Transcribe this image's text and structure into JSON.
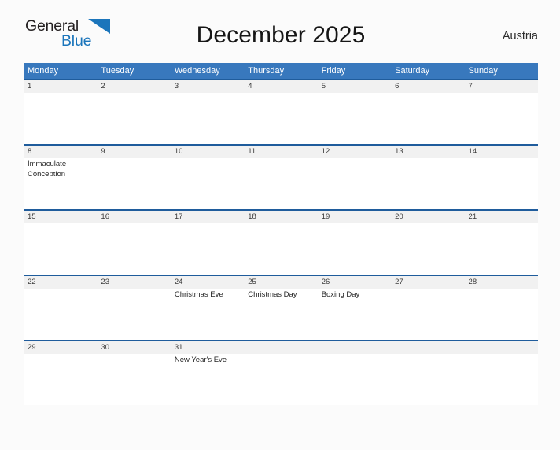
{
  "brand": {
    "name_part1": "General",
    "name_part2": "Blue",
    "flag_icon": "triangle-flag-icon",
    "accent_color": "#1b75bb"
  },
  "header": {
    "title": "December 2025",
    "country": "Austria"
  },
  "colors": {
    "weekday_header_bg": "#3878bd",
    "week_separator": "#1f5c9c",
    "daynum_band_bg": "#f1f1f1",
    "page_bg": "#fbfbfb"
  },
  "calendar": {
    "month": "December",
    "year": "2025",
    "weekday_headers": [
      "Monday",
      "Tuesday",
      "Wednesday",
      "Thursday",
      "Friday",
      "Saturday",
      "Sunday"
    ],
    "weeks": [
      {
        "days": [
          {
            "number": "1",
            "event": ""
          },
          {
            "number": "2",
            "event": ""
          },
          {
            "number": "3",
            "event": ""
          },
          {
            "number": "4",
            "event": ""
          },
          {
            "number": "5",
            "event": ""
          },
          {
            "number": "6",
            "event": ""
          },
          {
            "number": "7",
            "event": ""
          }
        ]
      },
      {
        "days": [
          {
            "number": "8",
            "event": "Immaculate Conception"
          },
          {
            "number": "9",
            "event": ""
          },
          {
            "number": "10",
            "event": ""
          },
          {
            "number": "11",
            "event": ""
          },
          {
            "number": "12",
            "event": ""
          },
          {
            "number": "13",
            "event": ""
          },
          {
            "number": "14",
            "event": ""
          }
        ]
      },
      {
        "days": [
          {
            "number": "15",
            "event": ""
          },
          {
            "number": "16",
            "event": ""
          },
          {
            "number": "17",
            "event": ""
          },
          {
            "number": "18",
            "event": ""
          },
          {
            "number": "19",
            "event": ""
          },
          {
            "number": "20",
            "event": ""
          },
          {
            "number": "21",
            "event": ""
          }
        ]
      },
      {
        "days": [
          {
            "number": "22",
            "event": ""
          },
          {
            "number": "23",
            "event": ""
          },
          {
            "number": "24",
            "event": "Christmas Eve"
          },
          {
            "number": "25",
            "event": "Christmas Day"
          },
          {
            "number": "26",
            "event": "Boxing Day"
          },
          {
            "number": "27",
            "event": ""
          },
          {
            "number": "28",
            "event": ""
          }
        ]
      },
      {
        "days": [
          {
            "number": "29",
            "event": ""
          },
          {
            "number": "30",
            "event": ""
          },
          {
            "number": "31",
            "event": "New Year's Eve"
          },
          {
            "number": "",
            "event": ""
          },
          {
            "number": "",
            "event": ""
          },
          {
            "number": "",
            "event": ""
          },
          {
            "number": "",
            "event": ""
          }
        ]
      }
    ]
  }
}
